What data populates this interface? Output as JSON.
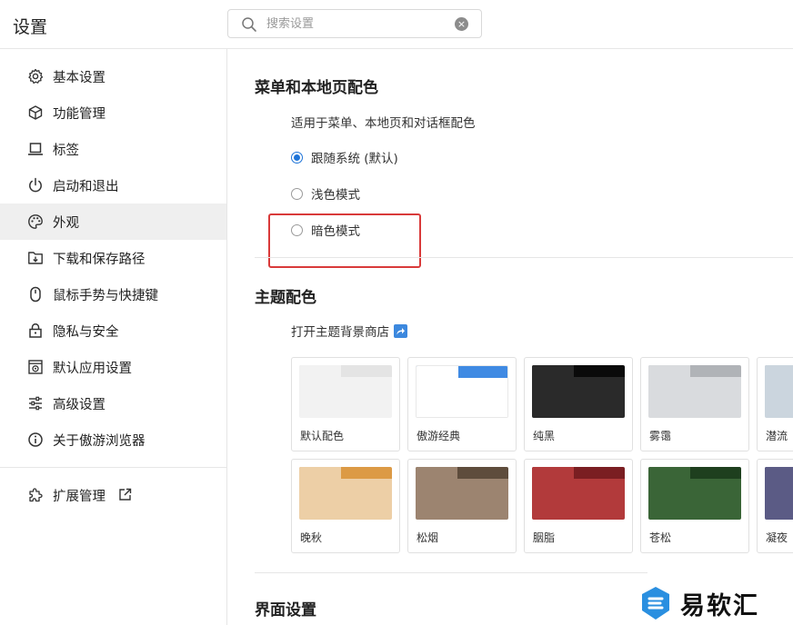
{
  "header": {
    "title": "设置",
    "search_placeholder": "搜索设置"
  },
  "sidebar": {
    "items": [
      {
        "label": "基本设置",
        "icon": "gear-icon"
      },
      {
        "label": "功能管理",
        "icon": "cube-icon"
      },
      {
        "label": "标签",
        "icon": "laptop-icon"
      },
      {
        "label": "启动和退出",
        "icon": "power-icon"
      },
      {
        "label": "外观",
        "icon": "palette-icon",
        "active": true
      },
      {
        "label": "下载和保存路径",
        "icon": "download-folder-icon"
      },
      {
        "label": "鼠标手势与快捷键",
        "icon": "mouse-icon"
      },
      {
        "label": "隐私与安全",
        "icon": "lock-icon"
      },
      {
        "label": "默认应用设置",
        "icon": "default-app-icon"
      },
      {
        "label": "高级设置",
        "icon": "sliders-icon"
      },
      {
        "label": "关于傲游浏览器",
        "icon": "info-icon"
      }
    ],
    "extension": {
      "label": "扩展管理",
      "icon": "puzzle-icon"
    }
  },
  "main": {
    "color_section": {
      "title": "菜单和本地页配色",
      "description": "适用于菜单、本地页和对话框配色",
      "options": [
        {
          "label": "跟随系统 (默认)",
          "checked": true
        },
        {
          "label": "浅色模式",
          "checked": false
        },
        {
          "label": "暗色模式",
          "checked": false
        }
      ]
    },
    "theme_section": {
      "title": "主题配色",
      "store_link": "打开主题背景商店",
      "themes": [
        {
          "name": "默认配色",
          "tabbar": "#e4e4e4",
          "tab": "#f2f2f2",
          "body": "#f2f2f2"
        },
        {
          "name": "傲游经典",
          "tabbar": "#3f8ae3",
          "tab": "#ffffff",
          "body": "#ffffff"
        },
        {
          "name": "纯黑",
          "tabbar": "#0a0a0a",
          "tab": "#2a2a2a",
          "body": "#2a2a2a"
        },
        {
          "name": "雾霭",
          "tabbar": "#b0b3b7",
          "tab": "#d9dbde",
          "body": "#d9dbde"
        },
        {
          "name": "潜流",
          "tabbar": "#a9b7c4",
          "tab": "#cbd5de",
          "body": "#cbd5de"
        },
        {
          "name": "晚秋",
          "tabbar": "#dc9a45",
          "tab": "#edcfa6",
          "body": "#edcfa6"
        },
        {
          "name": "松烟",
          "tabbar": "#5e4c3c",
          "tab": "#9c8470",
          "body": "#9c8470"
        },
        {
          "name": "胭脂",
          "tabbar": "#7a1e22",
          "tab": "#b23a3b",
          "body": "#b23a3b"
        },
        {
          "name": "苍松",
          "tabbar": "#1e3f1e",
          "tab": "#3a6537",
          "body": "#3a6537"
        },
        {
          "name": "凝夜",
          "tabbar": "#272a4a",
          "tab": "#5b5b85",
          "body": "#5b5b85"
        }
      ]
    },
    "interface_section": {
      "title": "界面设置"
    }
  },
  "watermark": {
    "text": "易软汇"
  },
  "colors": {
    "accent": "#1e74d8",
    "highlight": "#d93a3a",
    "active_bg": "#efefef"
  }
}
